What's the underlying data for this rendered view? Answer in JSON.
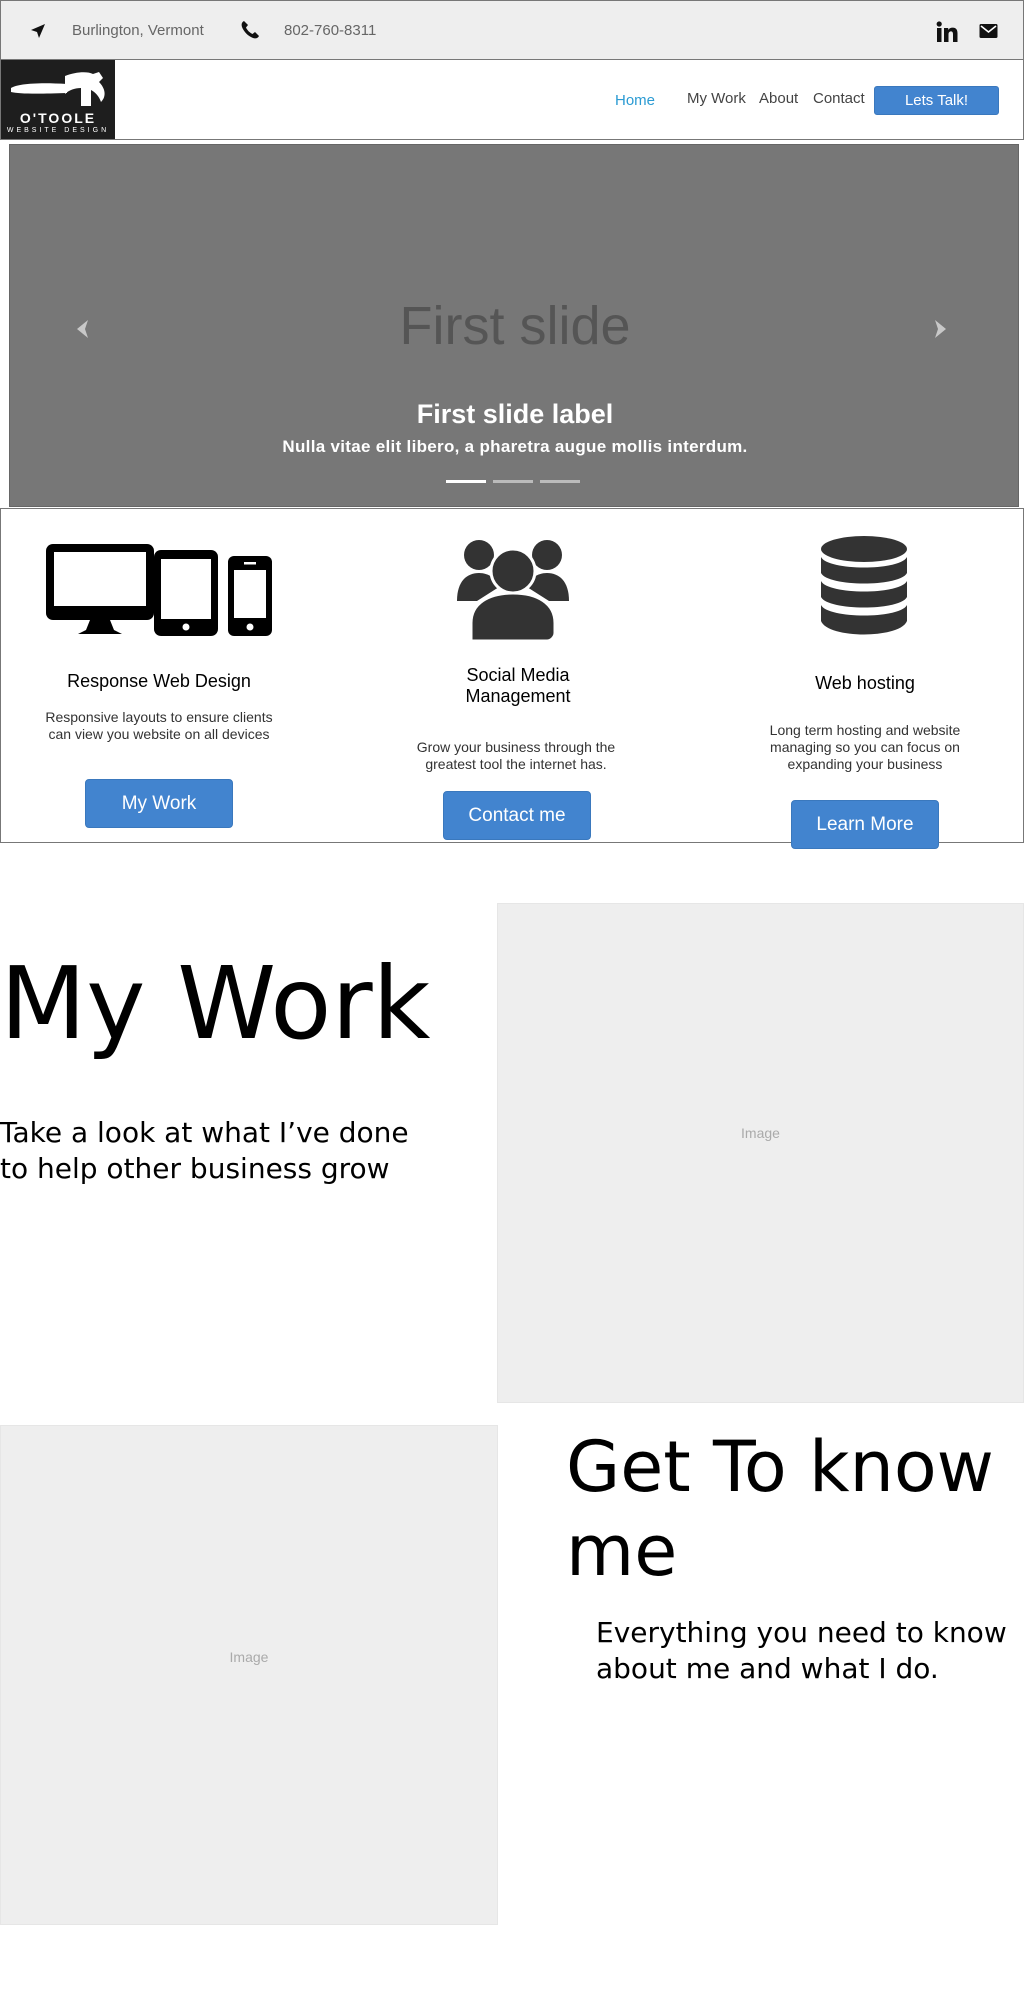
{
  "topbar": {
    "location": "Burlington, Vermont",
    "phone": "802-760-8311",
    "icons": [
      "location-arrow-icon",
      "phone-icon",
      "linkedin-icon",
      "mail-icon"
    ]
  },
  "header": {
    "logo_name": "O'TOOLE",
    "logo_sub": "WEBSITE DESIGN",
    "nav": {
      "home": "Home",
      "my_work": "My Work",
      "about": "About",
      "contact": "Contact"
    },
    "cta": "Lets Talk!"
  },
  "carousel": {
    "slide_title": "First slide",
    "label": "First slide label",
    "caption": "Nulla vitae elit libero, a pharetra augue mollis interdum.",
    "indicator_count": 3,
    "active_index": 0
  },
  "services": [
    {
      "title": "Response Web Design",
      "description": "Responsive layouts to ensure clients can view you website on all devices",
      "button": "My Work",
      "icon": "devices-icon"
    },
    {
      "title": "Social Media Management",
      "description": "Grow your business through the greatest tool the internet has.",
      "button": "Contact me",
      "icon": "users-icon"
    },
    {
      "title": "Web hosting",
      "description": "Long term hosting and website managing so you can focus on expanding your business",
      "button": "Learn More",
      "icon": "database-icon"
    }
  ],
  "my_work": {
    "title": "My Work",
    "subtitle": "Take a look at what I’ve done to help other business grow",
    "image_label": "Image"
  },
  "get_to_know": {
    "title": "Get To know me",
    "subtitle": "Everything you need to know about me and what I do.",
    "image_label": "Image"
  },
  "colors": {
    "accent": "#4284cf",
    "nav_active": "#2b9bd3",
    "topbar_bg": "#eeeeee",
    "carousel_bg": "#777777",
    "placeholder_bg": "#eeeeee"
  }
}
